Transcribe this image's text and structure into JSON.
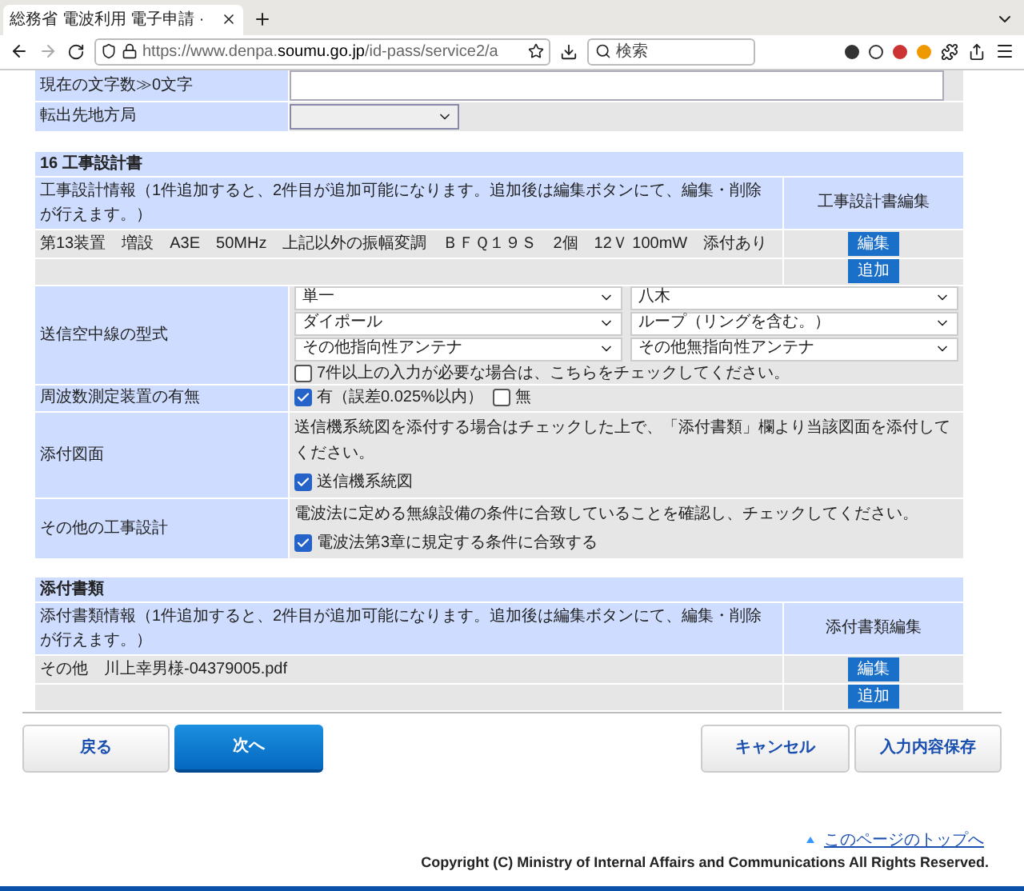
{
  "browser": {
    "tab_title": "総務省 電波利用 電子申請 ·",
    "url_prefix": "https://www.denpa.",
    "url_domain": "soumu.go.jp",
    "url_path": "/id-pass/service2/a",
    "search_placeholder": "検索"
  },
  "top_rows": [
    {
      "kind": "textarea",
      "label": "現在の文字数≫0文字"
    },
    {
      "kind": "select",
      "label": "転出先地方局"
    }
  ],
  "design": {
    "title": "16 工事設計書",
    "info": "工事設計情報（1件追加すると、2件目が追加可能になります。追加後は編集ボタンにて、編集・削除が行えます。）",
    "edit_header": "工事設計書編集",
    "entries": [
      {
        "text": "第13装置　増設　A3E　50MHz　上記以外の振幅変調　ＢＦＱ１９Ｓ　2個　12Ｖ 100mW　添付あり",
        "button": "編集"
      }
    ],
    "add_button": "追加",
    "antenna": {
      "label": "送信空中線の型式",
      "options": [
        "単一",
        "八木",
        "ダイポール",
        "ループ（リングを含む。）",
        "その他指向性アンテナ",
        "その他無指向性アンテナ"
      ],
      "more": {
        "label": "7件以上の入力が必要な場合は、こちらをチェックしてください。",
        "checked": false
      }
    },
    "frequency": {
      "label": "周波数測定装置の有無",
      "options": [
        {
          "label": "有（誤差0.025%以内）",
          "checked": true
        },
        {
          "label": "無",
          "checked": false
        }
      ]
    },
    "drawing": {
      "label": "添付図面",
      "note": "送信機系統図を添付する場合はチェックした上で、「添付書類」欄より当該図面を添付してください。",
      "checkbox": {
        "label": "送信機系統図",
        "checked": true
      }
    },
    "other": {
      "label": "その他の工事設計",
      "note": "電波法に定める無線設備の条件に合致していることを確認し、チェックしてください。",
      "checkbox": {
        "label": "電波法第3章に規定する条件に合致する",
        "checked": true
      }
    }
  },
  "attachments": {
    "title": "添付書類",
    "info": "添付書類情報（1件追加すると、2件目が追加可能になります。追加後は編集ボタンにて、編集・削除が行えます。）",
    "edit_header": "添付書類編集",
    "entries": [
      {
        "text": "その他　川上幸男様-04379005.pdf",
        "button": "編集"
      }
    ],
    "add_button": "追加"
  },
  "buttons": {
    "back": "戻る",
    "next": "次へ",
    "cancel": "キャンセル",
    "save": "入力内容保存"
  },
  "top_link": "このページのトップへ",
  "copyright": "Copyright (C) Ministry of Internal Affairs and Communications All Rights Reserved."
}
